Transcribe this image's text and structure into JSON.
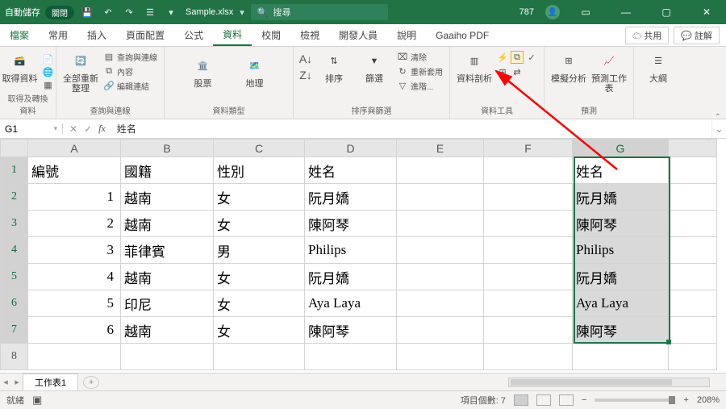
{
  "titlebar": {
    "autosave": "自動儲存",
    "autosave_state": "關閉",
    "filename": "Sample.xlsx",
    "search": "搜尋",
    "user_num": "787"
  },
  "tabs": {
    "file": "檔案",
    "home": "常用",
    "insert": "插入",
    "layout": "頁面配置",
    "formulas": "公式",
    "data": "資料",
    "review": "校閱",
    "view": "檢視",
    "dev": "開發人員",
    "help": "說明",
    "gaaiho": "Gaaiho PDF",
    "share": "共用",
    "comments": "註解"
  },
  "ribbon": {
    "g1": {
      "btn1": "取得資料",
      "btn2": "全部重新整理",
      "s1": "查詢與連線",
      "s2": "內容",
      "s3": "編輯連結",
      "label": "取得及轉換資料",
      "label2": "查詢與連線"
    },
    "g2": {
      "btn1": "股票",
      "btn2": "地理",
      "label": "資料類型"
    },
    "g3": {
      "sort": "排序",
      "filter": "篩選",
      "clear": "清除",
      "reapply": "重新套用",
      "adv": "進階...",
      "label": "排序與篩選"
    },
    "g4": {
      "t2c": "資料剖析",
      "label": "資料工具"
    },
    "g5": {
      "whatif": "模擬分析",
      "forecast": "預測工作表",
      "label": "預測"
    },
    "g6": {
      "outline": "大綱",
      "label": ""
    }
  },
  "namebox": "G1",
  "formula": "姓名",
  "headers": [
    "A",
    "B",
    "C",
    "D",
    "E",
    "F",
    "G"
  ],
  "rows": [
    {
      "n": "1",
      "a": "編號",
      "b": "國籍",
      "c": "性別",
      "d": "姓名",
      "g": "姓名"
    },
    {
      "n": "2",
      "a": "1",
      "b": "越南",
      "c": "女",
      "d": "阮月嬌",
      "g": "阮月嬌"
    },
    {
      "n": "3",
      "a": "2",
      "b": "越南",
      "c": "女",
      "d": "陳阿琴",
      "g": "陳阿琴"
    },
    {
      "n": "4",
      "a": "3",
      "b": "菲律賓",
      "c": "男",
      "d": "Philips",
      "g": "Philips"
    },
    {
      "n": "5",
      "a": "4",
      "b": "越南",
      "c": "女",
      "d": "阮月嬌",
      "g": "阮月嬌"
    },
    {
      "n": "6",
      "a": "5",
      "b": "印尼",
      "c": "女",
      "d": "Aya Laya",
      "g": "Aya Laya"
    },
    {
      "n": "7",
      "a": "6",
      "b": "越南",
      "c": "女",
      "d": "陳阿琴",
      "g": "陳阿琴"
    },
    {
      "n": "8",
      "a": "",
      "b": "",
      "c": "",
      "d": "",
      "g": ""
    }
  ],
  "sheet": "工作表1",
  "status": {
    "ready": "就緒",
    "count": "項目個數: 7",
    "zoom": "208%"
  }
}
